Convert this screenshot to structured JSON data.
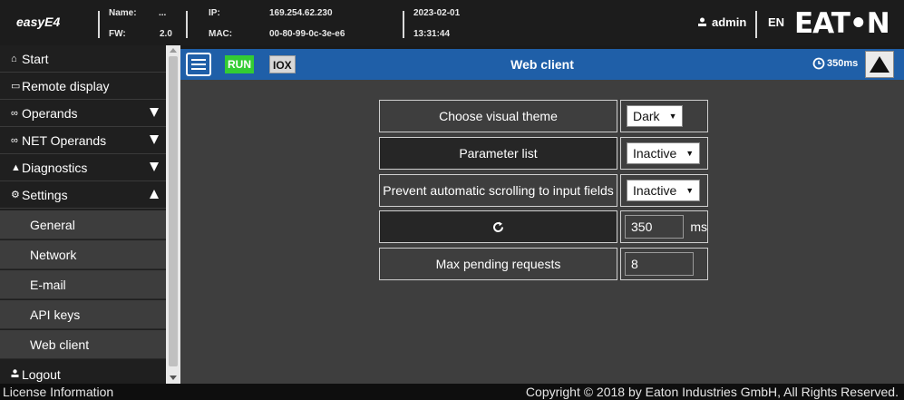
{
  "header": {
    "app_name": "easyE4",
    "name_label": "Name:",
    "name_value": "...",
    "fw_label": "FW:",
    "fw_value": "2.0",
    "ip_label": "IP:",
    "ip_value": "169.254.62.230",
    "mac_label": "MAC:",
    "mac_value": "00-80-99-0c-3e-e6",
    "date": "2023-02-01",
    "time": "13:31:44",
    "user": "admin",
    "language": "EN",
    "logo_text": "EAT•N"
  },
  "sidebar": {
    "items": [
      {
        "label": "Start",
        "icon": "home-icon",
        "glyph": "⌂"
      },
      {
        "label": "Remote display",
        "icon": "monitor-icon",
        "glyph": "▭"
      },
      {
        "label": "Operands",
        "icon": "infinity-icon",
        "glyph": "∞"
      },
      {
        "label": "NET Operands",
        "icon": "infinity-icon",
        "glyph": "∞"
      },
      {
        "label": "Diagnostics",
        "icon": "warning-icon",
        "glyph": "▲"
      },
      {
        "label": "Settings",
        "icon": "gear-icon",
        "glyph": "⚙"
      }
    ],
    "sub_items": [
      "General",
      "Network",
      "E-mail",
      "API keys",
      "Web client"
    ],
    "logout": "Logout"
  },
  "toolbar": {
    "run": "RUN",
    "iox": "IOX",
    "title": "Web client",
    "refresh_rate": "350ms"
  },
  "settings": {
    "theme_label": "Choose visual theme",
    "theme_value": "Dark",
    "param_label": "Parameter list",
    "param_value": "Inactive",
    "scroll_label": "Prevent automatic scrolling to input fields",
    "scroll_value": "Inactive",
    "refresh_value": "350",
    "refresh_unit": "ms",
    "max_pending_label": "Max pending requests",
    "max_pending_value": "8"
  },
  "footer": {
    "license": "License Information",
    "copyright": "Copyright © 2018 by Eaton Industries GmbH, All Rights Reserved."
  }
}
